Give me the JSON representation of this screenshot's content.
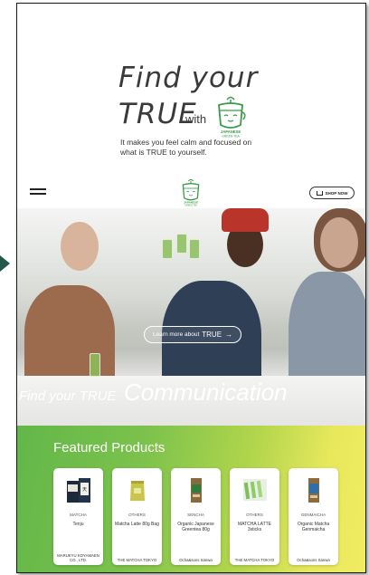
{
  "hero": {
    "line1": "Find your",
    "line2": "TRUE",
    "with": "with",
    "tagline": "It makes you feel calm and focused on what is TRUE to yourself.",
    "logo_caption": "JAPANESE GREEN TEA"
  },
  "nav": {
    "logo_caption": "JAPANESE GREEN TEA",
    "shop_label": "SHOP NOW"
  },
  "banner": {
    "learn_prefix": "Learn more about",
    "learn_true": "TRUE",
    "learn_arrow": "→",
    "caption_small": "Find your TRUE",
    "caption_big": "Communication"
  },
  "featured": {
    "title": "Featured Products",
    "products": [
      {
        "category": "MATCHA",
        "name": "Tenju",
        "maker": "MARUKYU KOYAMAEN CO., LTD."
      },
      {
        "category": "OTHERS",
        "name": "Matcha Latte 80g Bag",
        "maker": "THE MATCHA TOKYO"
      },
      {
        "category": "SENCHA",
        "name": "Organic Japanese Greentea 80g",
        "maker": "Ocha&sons Sanwa"
      },
      {
        "category": "OTHERS",
        "name": "MATCHA LATTE 3sticks",
        "maker": "THE MATCHA TOKYO"
      },
      {
        "category": "GENMAICHA",
        "name": "Organic Matcha Genmaicha",
        "maker": "Ocha&sons Sanwa"
      }
    ]
  },
  "colors": {
    "brand_green": "#2f8a3a",
    "featured_gradient_start": "#62b74a",
    "featured_gradient_end": "#f0ec63"
  }
}
